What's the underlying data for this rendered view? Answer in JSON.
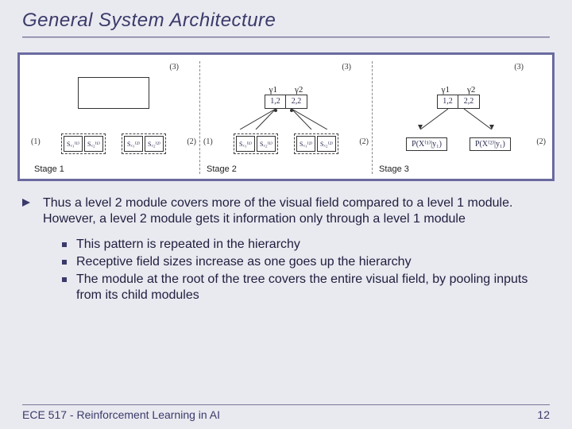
{
  "title": "General System Architecture",
  "figure": {
    "tag3": "(3)",
    "tag1": "(1)",
    "tag2": "(2)",
    "gamma1": "γ1",
    "gamma2": "γ2",
    "cell_12": "1,2",
    "cell_22": "2,2",
    "s1_X1": "Sₓ₁⁽¹⁾",
    "s1_X2": "Sₓ₂⁽¹⁾",
    "s2_X1": "Sₓ₁⁽²⁾",
    "s2_X2": "Sₓ₂⁽²⁾",
    "p1": "P(X⁽¹⁾|y₁)",
    "p2": "P(X⁽²⁾|y₁)",
    "stage1": "Stage 1",
    "stage2": "Stage 2",
    "stage3": "Stage 3"
  },
  "main_bullet": "Thus a level 2 module covers more of the visual field compared to a level 1 module. However, a level 2 module gets it information only through a level 1 module",
  "sub_bullets": [
    "This pattern is repeated in the hierarchy",
    "Receptive field sizes increase as one goes up the hierarchy",
    "The module at the root of the tree covers the entire visual field, by pooling inputs from its child modules"
  ],
  "footer_left": "ECE 517 - Reinforcement Learning in AI",
  "footer_right": "12"
}
